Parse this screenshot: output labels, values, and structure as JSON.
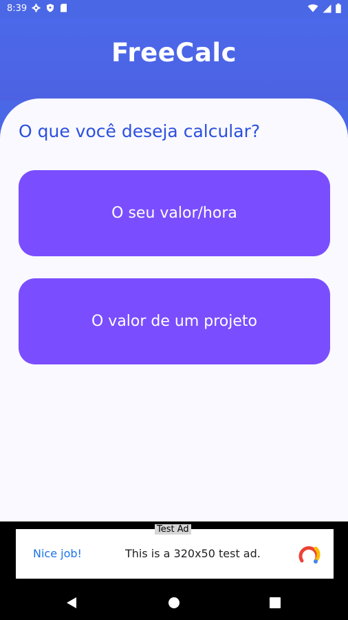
{
  "status_bar": {
    "time": "8:39",
    "left_icons": [
      "gear-icon",
      "shield-icon",
      "sim-card-icon"
    ],
    "right_icons": [
      "wifi-icon",
      "signal-icon",
      "battery-icon"
    ]
  },
  "app": {
    "title": "FreeCalc"
  },
  "main": {
    "question": "O que você deseja calcular?",
    "options": [
      {
        "label": "O seu valor/hora"
      },
      {
        "label": "O valor de um projeto"
      }
    ]
  },
  "ad": {
    "label": "Test Ad",
    "cta": "Nice job!",
    "text": "This is a 320x50 test ad.",
    "logo_icon": "admob-logo-icon"
  },
  "navigation": {
    "buttons": [
      "back-icon",
      "home-icon",
      "recents-icon"
    ]
  },
  "colors": {
    "header": "#4a67e6",
    "question": "#2c4fde",
    "button": "#7a4eff",
    "card": "#f9f9ff",
    "ad_cta": "#1a73e8"
  }
}
